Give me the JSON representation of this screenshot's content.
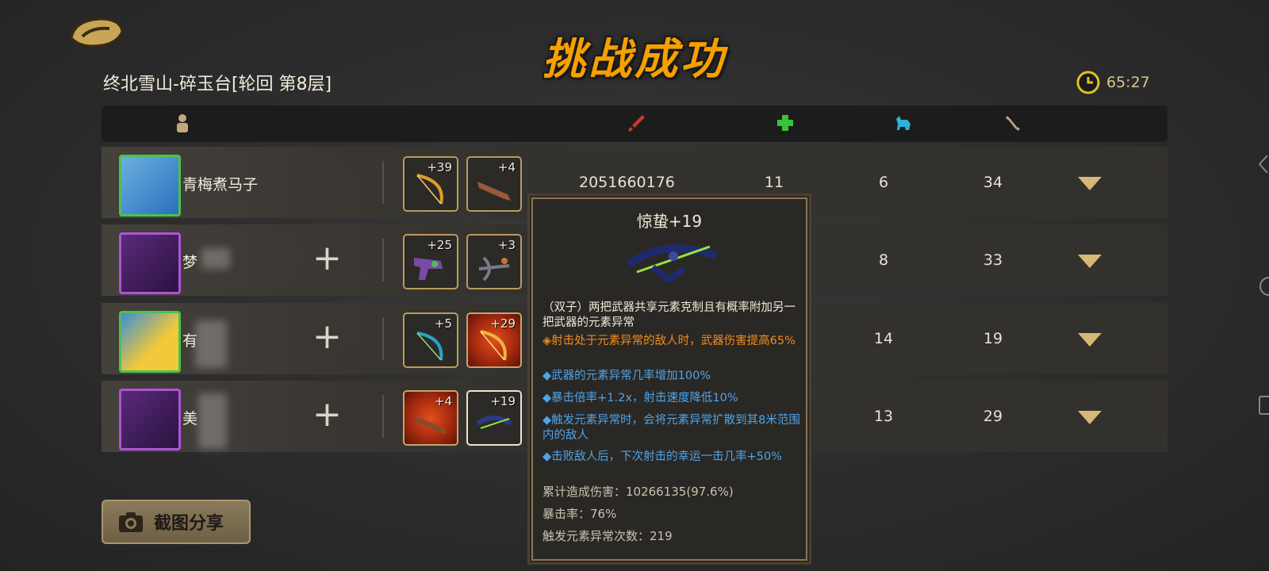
{
  "title": "挑战成功",
  "stage": "终北雪山-碎玉台[轮回  第8层]",
  "timer": "65:27",
  "header_icons": [
    "player-icon",
    "damage-icon",
    "heal-icon",
    "pet-icon",
    "bone-icon"
  ],
  "players": [
    {
      "name": "青梅煮马子",
      "weapons": [
        {
          "level": "+39"
        },
        {
          "level": "+4"
        }
      ],
      "damage": "2051660176",
      "heal": "11",
      "pet": "6",
      "bone": "34"
    },
    {
      "name": "梦",
      "weapons": [
        {
          "level": "+25"
        },
        {
          "level": "+3"
        }
      ],
      "plus": "+",
      "pet": "8",
      "bone": "33"
    },
    {
      "name": "有",
      "weapons": [
        {
          "level": "+5"
        },
        {
          "level": "+29"
        }
      ],
      "plus": "+",
      "pet": "14",
      "bone": "19"
    },
    {
      "name": "美",
      "weapons": [
        {
          "level": "+4"
        },
        {
          "level": "+19"
        }
      ],
      "plus": "+",
      "pet": "13",
      "bone": "29"
    }
  ],
  "share": {
    "label": "截图分享"
  },
  "tooltip": {
    "title": "惊蛰+19",
    "desc": "（双子）两把武器共享元素克制且有概率附加另一把武器的元素异常",
    "orange": "◈射击处于元素异常的敌人时，武器伤害提高65%",
    "blue": [
      "◆武器的元素异常几率增加100%",
      "◆暴击倍率+1.2x，射击速度降低10%",
      "◆触发元素异常时，会将元素异常扩散到其8米范围内的敌人",
      "◆击败敌人后，下次射击的幸运一击几率+50%"
    ],
    "stats": [
      "累计造成伤害：10266135(97.6%)",
      "暴击率：76%",
      "触发元素异常次数：219"
    ]
  },
  "colors": {
    "title": "#f6a000",
    "accent_gold": "#d7b878",
    "orange_text": "#f08a1c",
    "blue_text": "#4ea3e8"
  }
}
